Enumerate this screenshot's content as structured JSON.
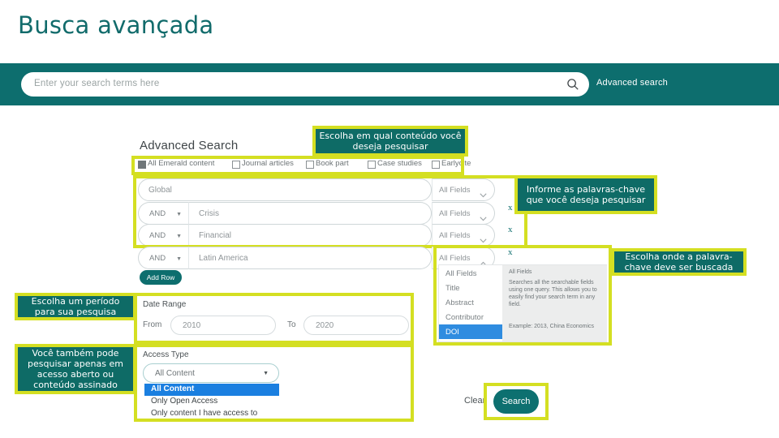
{
  "page": {
    "title": "Busca avançada"
  },
  "searchbar": {
    "placeholder": "Enter your search terms here",
    "advanced_link": "Advanced search",
    "search_icon": "search-icon"
  },
  "panel": {
    "title": "Advanced Search",
    "content_types": [
      {
        "label": "All Emerald content",
        "checked": true
      },
      {
        "label": "Journal articles",
        "checked": false
      },
      {
        "label": "Book part",
        "checked": false
      },
      {
        "label": "Case studies",
        "checked": false
      },
      {
        "label": "Earlycite",
        "checked": false
      }
    ],
    "rows": [
      {
        "boolean": "",
        "term": "Global",
        "field": "All Fields",
        "chevron": "chevron-down-icon",
        "remove": ""
      },
      {
        "boolean": "AND",
        "term": "Crisis",
        "field": "All Fields",
        "chevron": "chevron-down-icon",
        "remove": "x"
      },
      {
        "boolean": "AND",
        "term": "Financial",
        "field": "All Fields",
        "chevron": "chevron-down-icon",
        "remove": "x"
      },
      {
        "boolean": "AND",
        "term": "Latin America",
        "field": "All Fields",
        "chevron": "chevron-up-icon",
        "remove": "x"
      }
    ],
    "add_row_label": "Add Row",
    "field_dropdown": {
      "options": [
        {
          "label": "All Fields",
          "selected": false
        },
        {
          "label": "Title",
          "selected": false
        },
        {
          "label": "Abstract",
          "selected": false
        },
        {
          "label": "Contributor",
          "selected": false
        },
        {
          "label": "DOI",
          "selected": true
        }
      ],
      "help_title": "All Fields",
      "help_body": "Searches all the searchable fields using one query. This allows you to easily find your search term in any field.",
      "help_example": "Example: 2013, China Economics"
    },
    "date_range": {
      "label": "Date Range",
      "from_label": "From",
      "from_value": "2010",
      "to_label": "To",
      "to_value": "2020"
    },
    "access_type": {
      "label": "Access Type",
      "selected": "All Content",
      "options": [
        {
          "label": "All Content",
          "selected": true
        },
        {
          "label": "Only Open Access",
          "selected": false
        },
        {
          "label": "Only content I have access to",
          "selected": false
        }
      ]
    },
    "clear_label": "Clear",
    "search_label": "Search"
  },
  "callouts": [
    {
      "id": "content-type",
      "text": "Escolha em qual conteúdo você deseja pesquisar"
    },
    {
      "id": "keywords",
      "text": "Informe as palavras-chave que você deseja pesquisar"
    },
    {
      "id": "field-scope",
      "text": "Escolha onde a palavra-chave deve ser buscada"
    },
    {
      "id": "date-period",
      "text": "Escolha um período para sua pesquisa"
    },
    {
      "id": "access",
      "text": "Você também pode pesquisar apenas em acesso aberto ou conteúdo assinado"
    }
  ],
  "colors": {
    "teal": "#0d6e6e",
    "callout_bg": "#0e6b66",
    "highlight": "#d4df22",
    "select_blue": "#1a7fe0"
  }
}
